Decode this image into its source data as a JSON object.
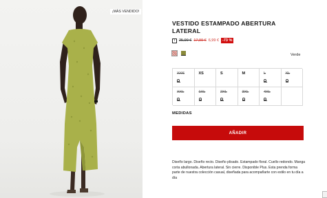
{
  "badge": "¡MÁS VENDIDO!",
  "product": {
    "title": "VESTIDO ESTAMPADO ABERTURA LATERAL",
    "info_icon": "i",
    "price_original": "25,99 €",
    "price_previous": "17,99 €",
    "price_current": "6,99 €",
    "discount": "-73 %",
    "color_name": "Verde",
    "swatches": [
      {
        "icon": "pattern-swatch",
        "color": "#c76b6b"
      },
      {
        "icon": "green-swatch",
        "color": "#8a8a3a",
        "selected": true
      }
    ]
  },
  "sizes": [
    {
      "label": "XXS",
      "available": false
    },
    {
      "label": "XS",
      "available": true
    },
    {
      "label": "S",
      "available": true
    },
    {
      "label": "M",
      "available": true
    },
    {
      "label": "L",
      "available": false
    },
    {
      "label": "XL",
      "available": false
    },
    {
      "label": "XXL",
      "available": false
    },
    {
      "label": "1XL",
      "available": false
    },
    {
      "label": "2XL",
      "available": false
    },
    {
      "label": "3XL",
      "available": false
    },
    {
      "label": "4XL",
      "available": false
    }
  ],
  "measures_label": "MEDIDAS",
  "add_button": "AÑADIR",
  "description": "Diseño largo. Diseño recto. Diseño plisado. Estampado floral. Cuello redondo. Manga corta abullonada. Abertura lateral. Sin cierre. Disponible Plus. Esta prenda forma parte de nuestra colección casual, diseñada para acompañarte con estilo en tu día a día",
  "colors": {
    "accent": "#c60b0b",
    "discount_red": "#d10e0e",
    "sale_text": "#d0322a",
    "dress": "#a9b14a"
  }
}
